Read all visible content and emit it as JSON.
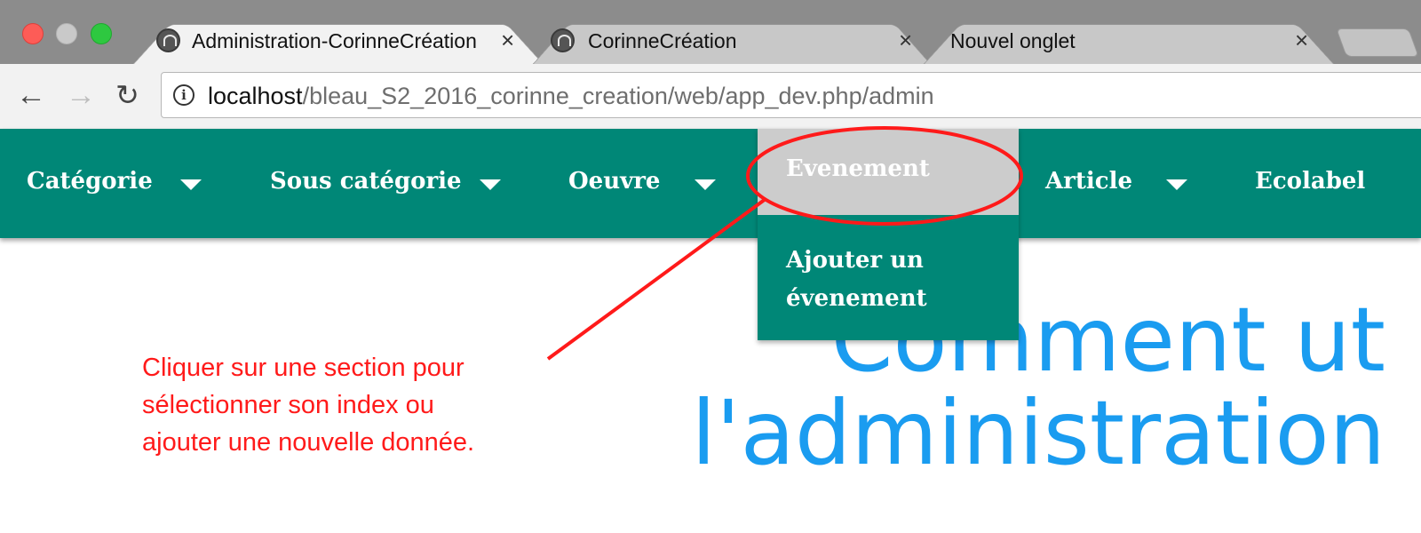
{
  "browser": {
    "tabs": [
      {
        "title": "Administration-CorinneCréation",
        "close": "×",
        "icon": "site-favicon"
      },
      {
        "title": "CorinneCréation",
        "close": "×",
        "icon": "site-favicon"
      },
      {
        "title": "Nouvel onglet",
        "close": "×"
      }
    ],
    "address": {
      "host": "localhost",
      "path": "/bleau_S2_2016_corinne_creation/web/app_dev.php/admin"
    },
    "nav": {
      "back": "←",
      "forward": "→",
      "reload": "↻",
      "info": "i"
    }
  },
  "navbar": {
    "items": [
      {
        "label": "Catégorie"
      },
      {
        "label": "Sous catégorie"
      },
      {
        "label": "Oeuvre"
      },
      {
        "label": "Article"
      },
      {
        "label": "Ecolabel"
      }
    ],
    "dropdown": {
      "header": "Evenement",
      "items": [
        "Ajouter un évenement"
      ]
    },
    "colors": {
      "bar": "#008777",
      "dropdown_header": "#cccccc"
    }
  },
  "hero": {
    "line1": "Comment ut",
    "line2": "l'administration",
    "color": "#1a9cf0"
  },
  "annotation": {
    "lines": [
      "Cliquer sur une section pour",
      "sélectionner son index ou",
      "ajouter une nouvelle donnée."
    ],
    "color": "#ff1a1a"
  }
}
